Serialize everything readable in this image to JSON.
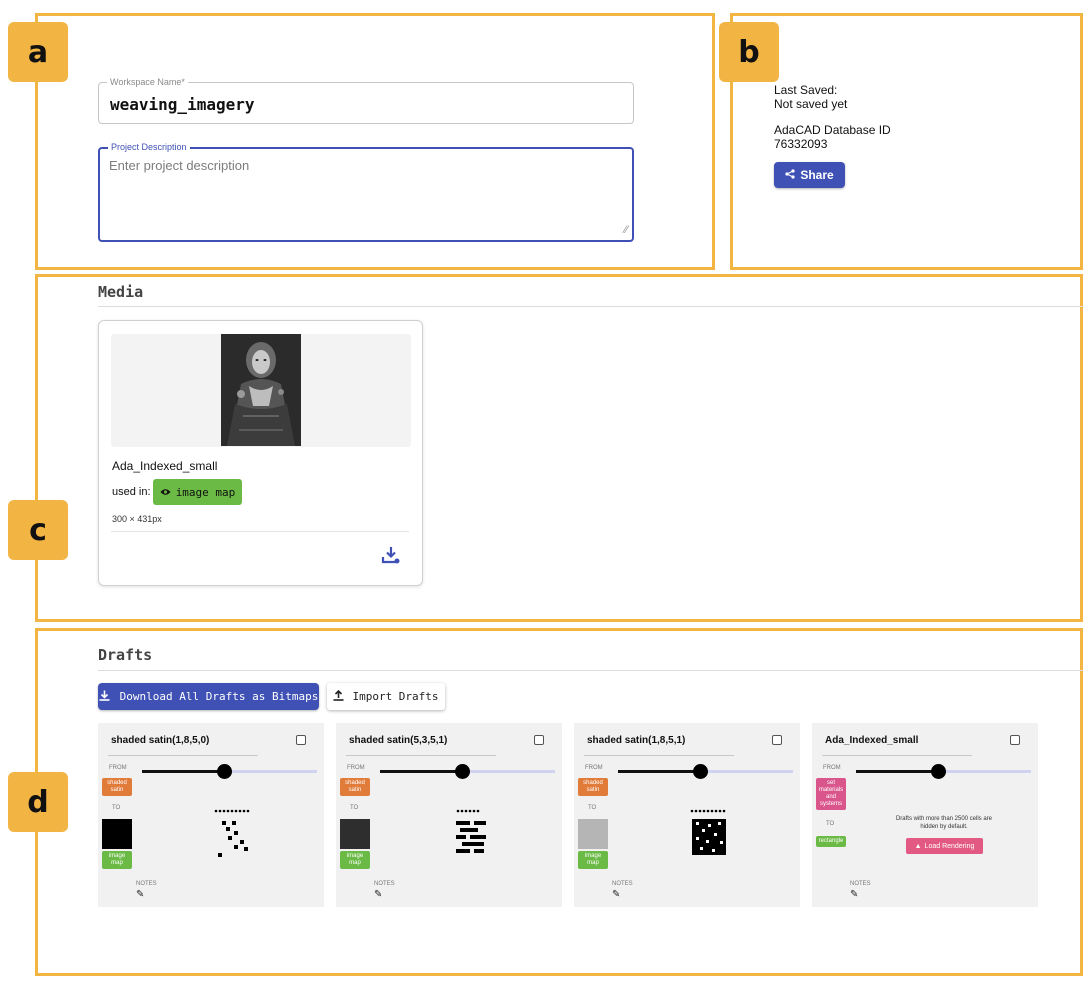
{
  "panel_labels": {
    "a": "a",
    "b": "b",
    "c": "c",
    "d": "d"
  },
  "workspace": {
    "name_label": "Workspace Name*",
    "name_value": "weaving_imagery",
    "description_label": "Project Description",
    "description_placeholder": "Enter project description"
  },
  "status": {
    "last_saved_label": "Last Saved:",
    "last_saved_value": "Not saved yet",
    "db_id_label": "AdaCAD Database ID",
    "db_id_value": "76332093",
    "share_label": "Share",
    "share_icon": "share-icon"
  },
  "media": {
    "section_title": "Media",
    "item": {
      "name": "Ada_Indexed_small",
      "used_in_label": "used in:",
      "used_in_chip": "image map",
      "chip_icon": "eye-icon",
      "dimensions": "300 × 431px",
      "download_icon": "download-icon"
    }
  },
  "drafts": {
    "section_title": "Drafts",
    "download_all_label": "Download All Drafts as Bitmaps",
    "import_label": "Import Drafts",
    "from_label": "FROM",
    "to_label": "TO",
    "notes_label": "NOTES",
    "cards": [
      {
        "title": "shaded satin(1,8,5,0)",
        "from_chip": "shaded satin",
        "to_chip": "image map"
      },
      {
        "title": "shaded satin(5,3,5,1)",
        "from_chip": "shaded satin",
        "to_chip": "image map"
      },
      {
        "title": "shaded satin(1,8,5,1)",
        "from_chip": "shaded satin",
        "to_chip": "image map"
      },
      {
        "title": "Ada_Indexed_small",
        "from_chip": "set materials and systems",
        "to_chip": "rectangle",
        "hidden_message": "Drafts with more than 2500 cells are hidden by default.",
        "load_label": "Load Rendering"
      }
    ]
  },
  "colors": {
    "panel_border": "#f2b544",
    "primary": "#3f51b5",
    "chip_orange": "#e07b39",
    "chip_green": "#6aba45",
    "chip_pink": "#d9558b",
    "load_button": "#e25a84"
  }
}
